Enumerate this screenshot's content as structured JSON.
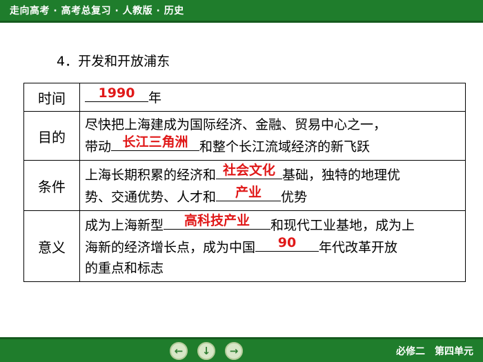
{
  "header": {
    "title": "走向高考 · 高考总复习 · 人教版 · 历史"
  },
  "section_heading": "4．开发和开放浦东",
  "table": {
    "time": {
      "label": "时间",
      "answer": "1990",
      "suffix": "年"
    },
    "purpose": {
      "label": "目的",
      "text1": "尽快把上海建成为国际经济、金融、贸易中心之一，",
      "text2_prefix": "带动",
      "answer": "长江三角洲",
      "text2_suffix": "和整个长江流域经济的新飞跃"
    },
    "conditions": {
      "label": "条件",
      "text1_prefix": "上海长期积累的经济和",
      "answer1": "社会文化",
      "text1_suffix": "基础，独特的地理优",
      "text2_prefix": "势、交通优势、人才和",
      "answer2": "产业",
      "text2_suffix": "优势"
    },
    "significance": {
      "label": "意义",
      "text1_prefix": "成为上海新型",
      "answer1": "高科技产业",
      "text1_suffix": "和现代工业基地，成为上",
      "text2_prefix": "海新的经济增长点，成为中国",
      "answer2": "90",
      "text2_suffix": "年代改革开放",
      "text3": "的重点和标志"
    }
  },
  "nav": {
    "prev_glyph": "←",
    "home_glyph": "↓",
    "next_glyph": "→"
  },
  "footer": {
    "text": "必修二　第四单元"
  }
}
